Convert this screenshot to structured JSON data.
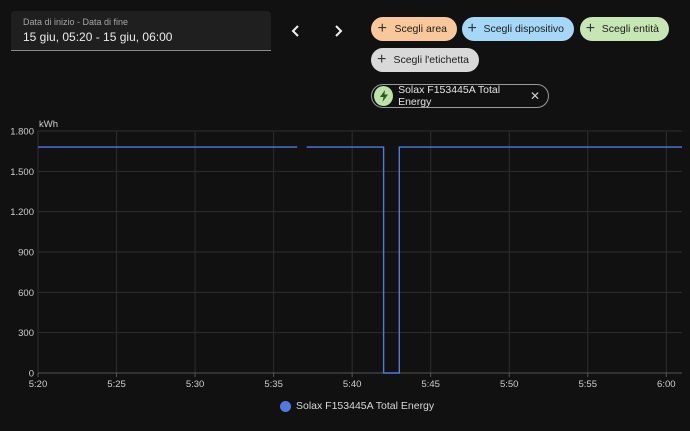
{
  "date_range": {
    "label": "Data di inizio - Data di fine",
    "value": "15 giu, 05:20 - 15 giu, 06:00"
  },
  "nav": {
    "prev_icon": "chevron-left-icon",
    "next_icon": "chevron-right-icon"
  },
  "chips": [
    {
      "label": "Scegli area",
      "color": "#f8c89a"
    },
    {
      "label": "Scegli dispositivo",
      "color": "#a5d8f6"
    },
    {
      "label": "Scegli entità",
      "color": "#c6e6b3"
    },
    {
      "label": "Scegli l'etichetta",
      "color": "#d9d9d9"
    }
  ],
  "entity_chip": {
    "label": "Solax F153445A Total Energy",
    "icon": "lightning-bolt-icon",
    "icon_color": "#bde3a8"
  },
  "chart_data": {
    "type": "line",
    "ylabel": "kWh",
    "yticks": [
      "0",
      "300",
      "600",
      "900",
      "1.200",
      "1.500",
      "1.800"
    ],
    "xticks": [
      "5:20",
      "5:25",
      "5:30",
      "5:35",
      "5:40",
      "5:45",
      "5:50",
      "5:55",
      "6:00"
    ],
    "ylim": [
      0,
      1800
    ],
    "xlim_minutes": [
      0,
      41
    ],
    "grid": true,
    "legend_position": "bottom-center",
    "series": [
      {
        "name": "Solax F153445A Total Energy",
        "color": "#4f7be0",
        "segments": [
          [
            [
              0,
              1680
            ],
            [
              16.5,
              1680
            ]
          ],
          [
            [
              17.1,
              1680
            ],
            [
              22,
              1680
            ],
            [
              22,
              0
            ],
            [
              23,
              0
            ],
            [
              23,
              1680
            ],
            [
              41,
              1680
            ]
          ]
        ]
      }
    ]
  }
}
